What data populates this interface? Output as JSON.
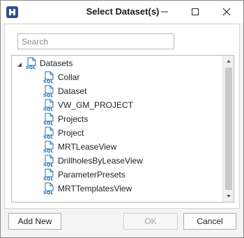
{
  "window": {
    "title": "Select Dataset(s)"
  },
  "search": {
    "placeholder": "Search",
    "value": ""
  },
  "tree": {
    "root": {
      "label": "Datasets",
      "expanded": true,
      "icon": "sql-file-icon"
    },
    "children": [
      {
        "label": "Collar"
      },
      {
        "label": "Dataset"
      },
      {
        "label": "VW_GM_PROJECT"
      },
      {
        "label": "Projects"
      },
      {
        "label": "Project"
      },
      {
        "label": "MRTLeaseView"
      },
      {
        "label": "DrillholesByLeaseView"
      },
      {
        "label": "ParameterPresets"
      },
      {
        "label": "MRTTemplatesView"
      }
    ]
  },
  "buttons": {
    "add_new": "Add New",
    "ok": "OK",
    "cancel": "Cancel"
  },
  "colors": {
    "sql_icon": "#1f6fb2",
    "app_icon_bg": "#2f4f8e"
  }
}
